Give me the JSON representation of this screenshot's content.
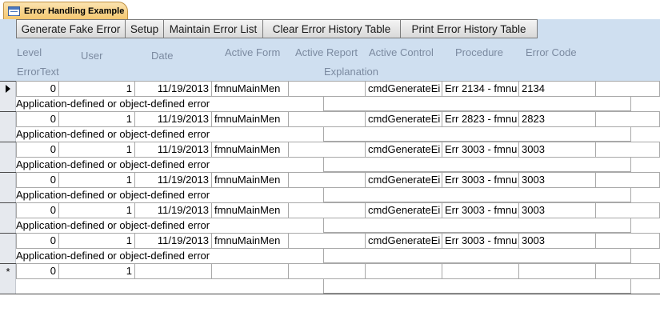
{
  "tab": {
    "title": "Error Handling Example",
    "icon": "form-icon"
  },
  "toolbar": {
    "buttons": [
      "Generate Fake Error",
      "Setup",
      "Maintain Error List",
      "Clear Error History Table",
      "Print Error History Table"
    ]
  },
  "headers": {
    "level": "Level",
    "user": "User",
    "date": "Date",
    "active_form": "Active Form",
    "active_report": "Active Report",
    "active_control": "Active Control",
    "procedure": "Procedure",
    "error_code": "Error Code",
    "error_text": "ErrorText",
    "explanation": "Explanation"
  },
  "records": [
    {
      "level": "0",
      "user": "1",
      "date": "11/19/2013",
      "active_form": "fmnuMainMen",
      "active_report": "",
      "active_control": "cmdGenerateEi",
      "procedure": "Err 2134 - fmnu",
      "error_code": "2134",
      "extra": "",
      "error_text": "Application-defined or object-defined error",
      "explanation": ""
    },
    {
      "level": "0",
      "user": "1",
      "date": "11/19/2013",
      "active_form": "fmnuMainMen",
      "active_report": "",
      "active_control": "cmdGenerateEi",
      "procedure": "Err 2823 - fmnu",
      "error_code": "2823",
      "extra": "",
      "error_text": "Application-defined or object-defined error",
      "explanation": ""
    },
    {
      "level": "0",
      "user": "1",
      "date": "11/19/2013",
      "active_form": "fmnuMainMen",
      "active_report": "",
      "active_control": "cmdGenerateEi",
      "procedure": "Err 3003 - fmnu",
      "error_code": "3003",
      "extra": "",
      "error_text": "Application-defined or object-defined error",
      "explanation": ""
    },
    {
      "level": "0",
      "user": "1",
      "date": "11/19/2013",
      "active_form": "fmnuMainMen",
      "active_report": "",
      "active_control": "cmdGenerateEi",
      "procedure": "Err 3003 - fmnu",
      "error_code": "3003",
      "extra": "",
      "error_text": "Application-defined or object-defined error",
      "explanation": ""
    },
    {
      "level": "0",
      "user": "1",
      "date": "11/19/2013",
      "active_form": "fmnuMainMen",
      "active_report": "",
      "active_control": "cmdGenerateEi",
      "procedure": "Err 3003 - fmnu",
      "error_code": "3003",
      "extra": "",
      "error_text": "Application-defined or object-defined error",
      "explanation": ""
    },
    {
      "level": "0",
      "user": "1",
      "date": "11/19/2013",
      "active_form": "fmnuMainMen",
      "active_report": "",
      "active_control": "cmdGenerateEi",
      "procedure": "Err 3003 - fmnu",
      "error_code": "3003",
      "extra": "",
      "error_text": "Application-defined or object-defined error",
      "explanation": ""
    },
    {
      "level": "0",
      "user": "1",
      "date": "",
      "active_form": "",
      "active_report": "",
      "active_control": "",
      "procedure": "",
      "error_code": "",
      "extra": "",
      "error_text": "",
      "explanation": ""
    }
  ],
  "record_markers": [
    "current-record-arrow",
    "",
    "",
    "",
    "",
    "",
    "*"
  ],
  "colors": {
    "header_band": "#cfdff0",
    "tab": "#f5c870",
    "header_text": "#7b8aa0"
  }
}
